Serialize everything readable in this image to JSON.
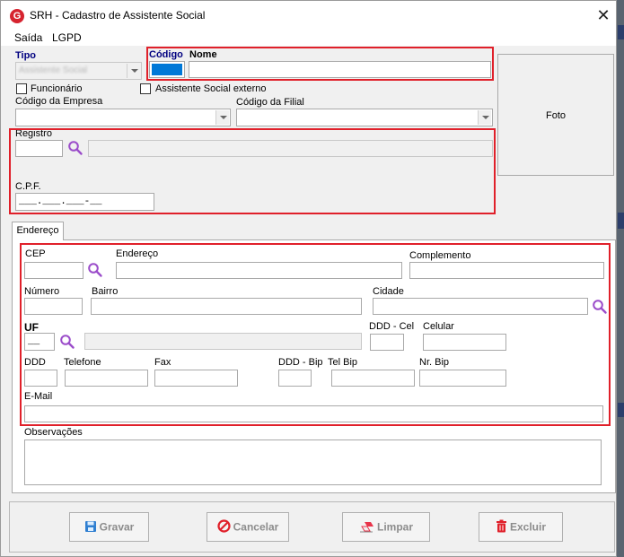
{
  "window": {
    "title": "SRH - Cadastro de Assistente Social",
    "close_glyph": "✕"
  },
  "menu": {
    "items": [
      "Saída",
      "LGPD"
    ]
  },
  "form": {
    "tipo_label": "Tipo",
    "tipo_value": "Assistente Social",
    "codigo_label": "Código",
    "nome_label": "Nome",
    "funcionario_label": "Funcionário",
    "externo_label": "Assistente Social externo",
    "empresa_label": "Código da Empresa",
    "filial_label": "Código da Filial",
    "registro_label": "Registro",
    "cpf_label": "C.P.F.",
    "cpf_mask": "___.___.___-__",
    "foto_label": "Foto"
  },
  "tab": {
    "label": "Endereço"
  },
  "address": {
    "cep_label": "CEP",
    "endereco_label": "Endereço",
    "complemento_label": "Complemento",
    "numero_label": "Número",
    "bairro_label": "Bairro",
    "cidade_label": "Cidade",
    "uf_label": "UF",
    "uf_mask": "__",
    "ddd_cel_label": "DDD - Cel",
    "celular_label": "Celular",
    "ddd_label": "DDD",
    "telefone_label": "Telefone",
    "fax_label": "Fax",
    "ddd_bip_label": "DDD - Bip",
    "tel_bip_label": "Tel Bip",
    "nr_bip_label": "Nr. Bip",
    "email_label": "E-Mail",
    "obs_label": "Observações"
  },
  "buttons": {
    "gravar": "Gravar",
    "cancelar": "Cancelar",
    "limpar": "Limpar",
    "excluir": "Excluir"
  },
  "colors": {
    "highlight_red": "#e0202a",
    "label_blue": "#000080",
    "codigo_fill": "#0078d7"
  }
}
